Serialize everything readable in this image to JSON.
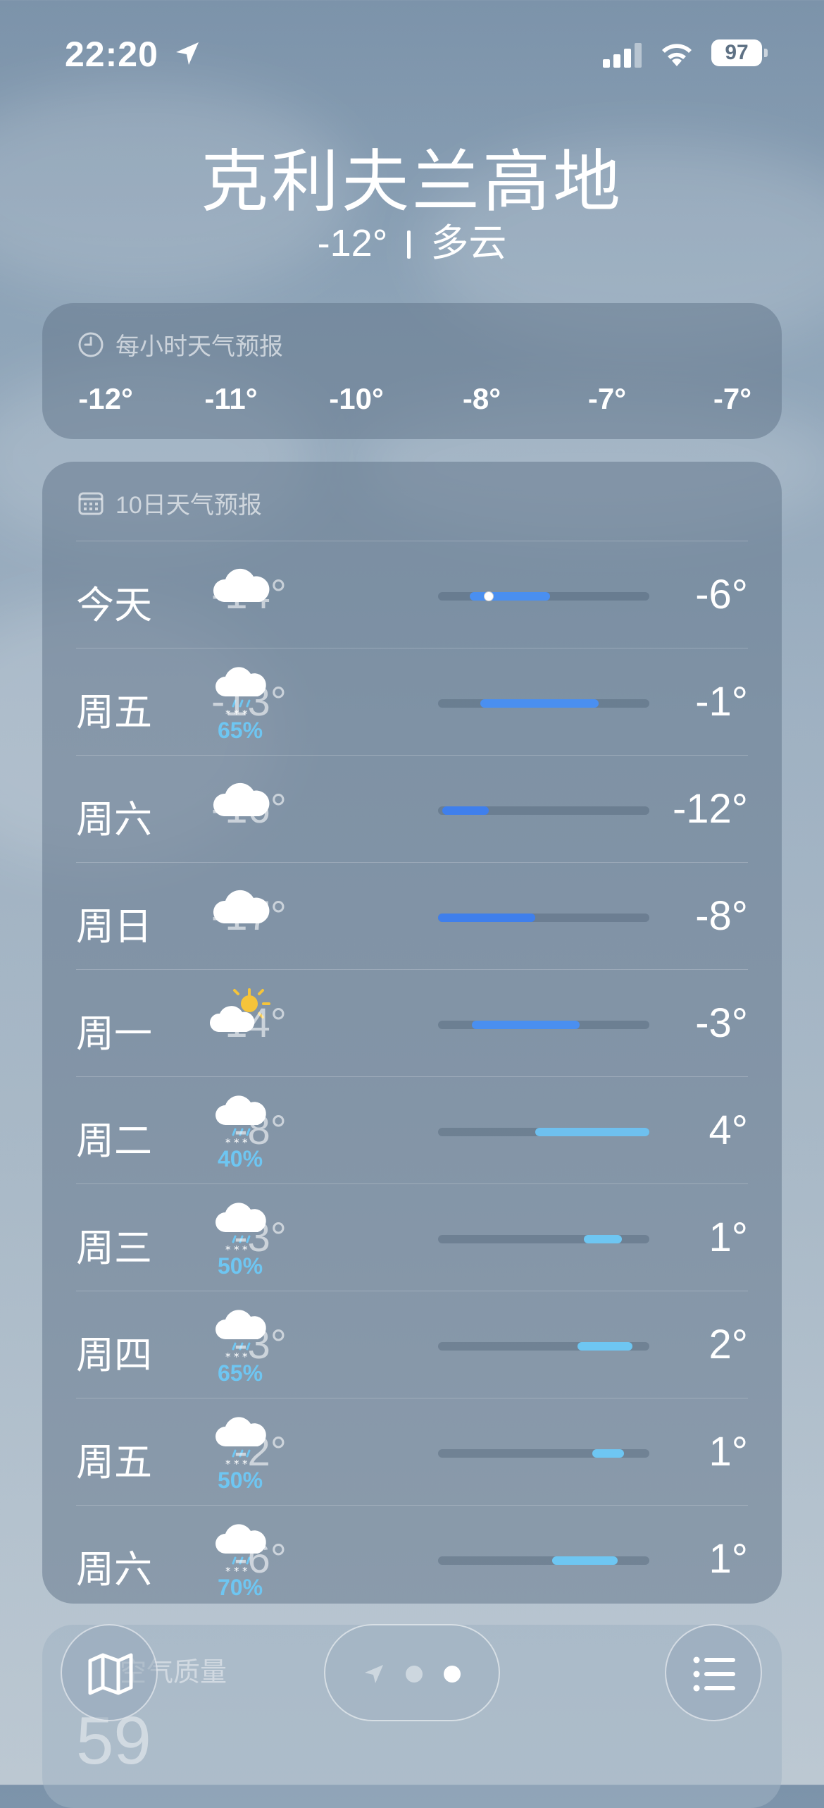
{
  "status_bar": {
    "time": "22:20",
    "battery": "97"
  },
  "location": {
    "city": "克利夫兰高地",
    "current_temp": "-12°",
    "condition": "多云"
  },
  "hourly": {
    "title": "每小时天气预报",
    "temps": [
      "-12°",
      "-11°",
      "-10°",
      "-8°",
      "-7°",
      "-7°"
    ]
  },
  "daily": {
    "title": "10日天气预报",
    "days": [
      {
        "day": "今天",
        "icon": "cloud-icon",
        "precip": "",
        "low": "-14°",
        "high": "-6°",
        "bar_start": 0.15,
        "bar_end": 0.53,
        "current_marker": 0.24,
        "color": "#4a8ff0"
      },
      {
        "day": "周五",
        "icon": "snow-cloud-icon",
        "precip": "65%",
        "low": "-13°",
        "high": "-1°",
        "bar_start": 0.2,
        "bar_end": 0.76,
        "color": "#4a8ff0"
      },
      {
        "day": "周六",
        "icon": "cloud-icon",
        "precip": "",
        "low": "-16°",
        "high": "-12°",
        "bar_start": 0.02,
        "bar_end": 0.24,
        "color": "#3f7fec"
      },
      {
        "day": "周日",
        "icon": "cloud-icon",
        "precip": "",
        "low": "-17°",
        "high": "-8°",
        "bar_start": 0.0,
        "bar_end": 0.46,
        "color": "#3f7fec"
      },
      {
        "day": "周一",
        "icon": "partly-sunny-icon",
        "precip": "",
        "low": "-14°",
        "high": "-3°",
        "bar_start": 0.16,
        "bar_end": 0.67,
        "color": "#4a8ff0"
      },
      {
        "day": "周二",
        "icon": "snow-cloud-icon",
        "precip": "40%",
        "low": "-8°",
        "high": "4°",
        "bar_start": 0.46,
        "bar_end": 1.0,
        "color": "#6ec0ef"
      },
      {
        "day": "周三",
        "icon": "snow-cloud-icon",
        "precip": "50%",
        "low": "-3°",
        "high": "1°",
        "bar_start": 0.69,
        "bar_end": 0.87,
        "color": "#6ec6f2"
      },
      {
        "day": "周四",
        "icon": "snow-cloud-icon",
        "precip": "65%",
        "low": "-3°",
        "high": "2°",
        "bar_start": 0.66,
        "bar_end": 0.92,
        "color": "#6ec6f2"
      },
      {
        "day": "周五",
        "icon": "snow-cloud-icon",
        "precip": "50%",
        "low": "-2°",
        "high": "1°",
        "bar_start": 0.73,
        "bar_end": 0.88,
        "color": "#6ec6f2"
      },
      {
        "day": "周六",
        "icon": "snow-cloud-icon",
        "precip": "70%",
        "low": "-6°",
        "high": "1°",
        "bar_start": 0.54,
        "bar_end": 0.85,
        "color": "#6ec6f2"
      }
    ]
  },
  "air_quality": {
    "title": "空气质量",
    "value": "59"
  },
  "bottom_bar": {
    "map_icon": "map-icon",
    "list_icon": "list-icon",
    "pages": [
      "location-arrow-page",
      "page-dot",
      "page-dot-active"
    ]
  }
}
